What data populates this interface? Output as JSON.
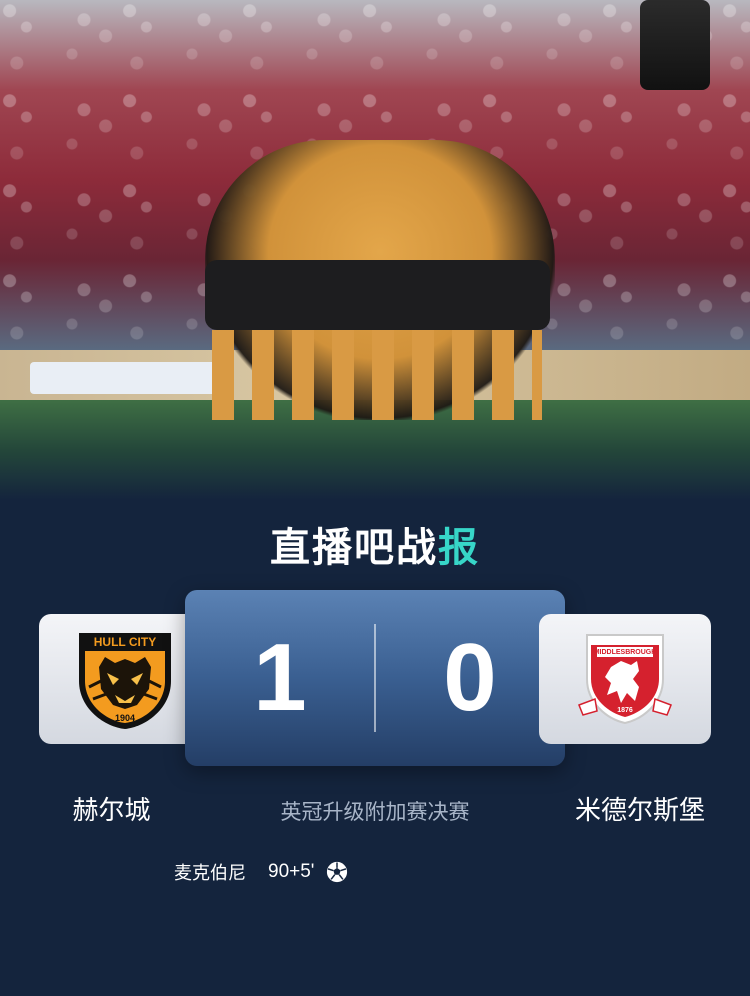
{
  "brand": {
    "main": "直播吧战",
    "accent": "报"
  },
  "match": {
    "home": {
      "name": "赫尔城",
      "score": "1",
      "logo_text": "HULL CITY",
      "logo_year": "1904"
    },
    "away": {
      "name": "米德尔斯堡",
      "score": "0",
      "logo_text": "MIDDLESBROUGH",
      "logo_year": "1876"
    },
    "competition": "英冠升级附加赛决赛"
  },
  "events": [
    {
      "player": "麦克伯尼",
      "minute": "90+5'",
      "icon": "soccer-ball-icon"
    }
  ],
  "colors": {
    "background": "#14243d",
    "score_card": "#3a5f91",
    "accent": "#37d6c8",
    "hull_orange": "#f39b1f",
    "boro_red": "#d5212e"
  }
}
